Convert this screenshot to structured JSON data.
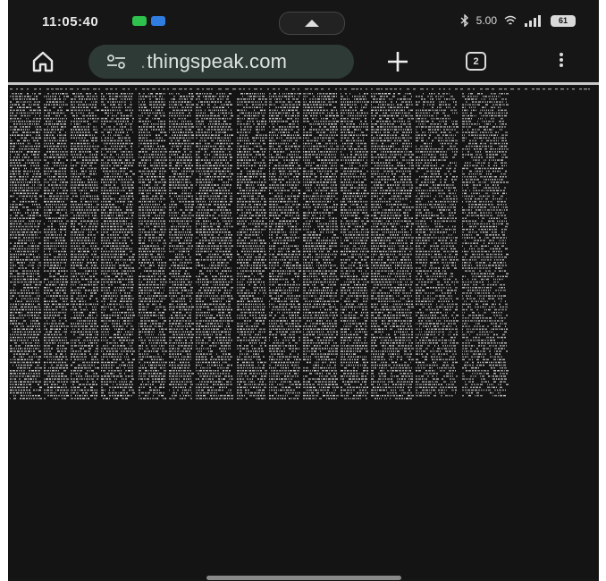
{
  "status_bar": {
    "time": "11:05:40",
    "network_speed": "5.00",
    "battery_level": "61",
    "colors": {
      "notif_green": "#2fc14d",
      "notif_blue": "#2f7de1"
    },
    "icons": [
      "bluetooth-icon",
      "signal-icon",
      "wifi-icon",
      "battery-icon"
    ]
  },
  "browser": {
    "url_display": "thingspeak.com",
    "tab_count": "2",
    "colors": {
      "url_pill": "#2e3a36",
      "toolbar_bg": "#161616"
    }
  },
  "page": {
    "header_text": "...",
    "background": "#141414",
    "text_color": "#d8d8d8"
  }
}
